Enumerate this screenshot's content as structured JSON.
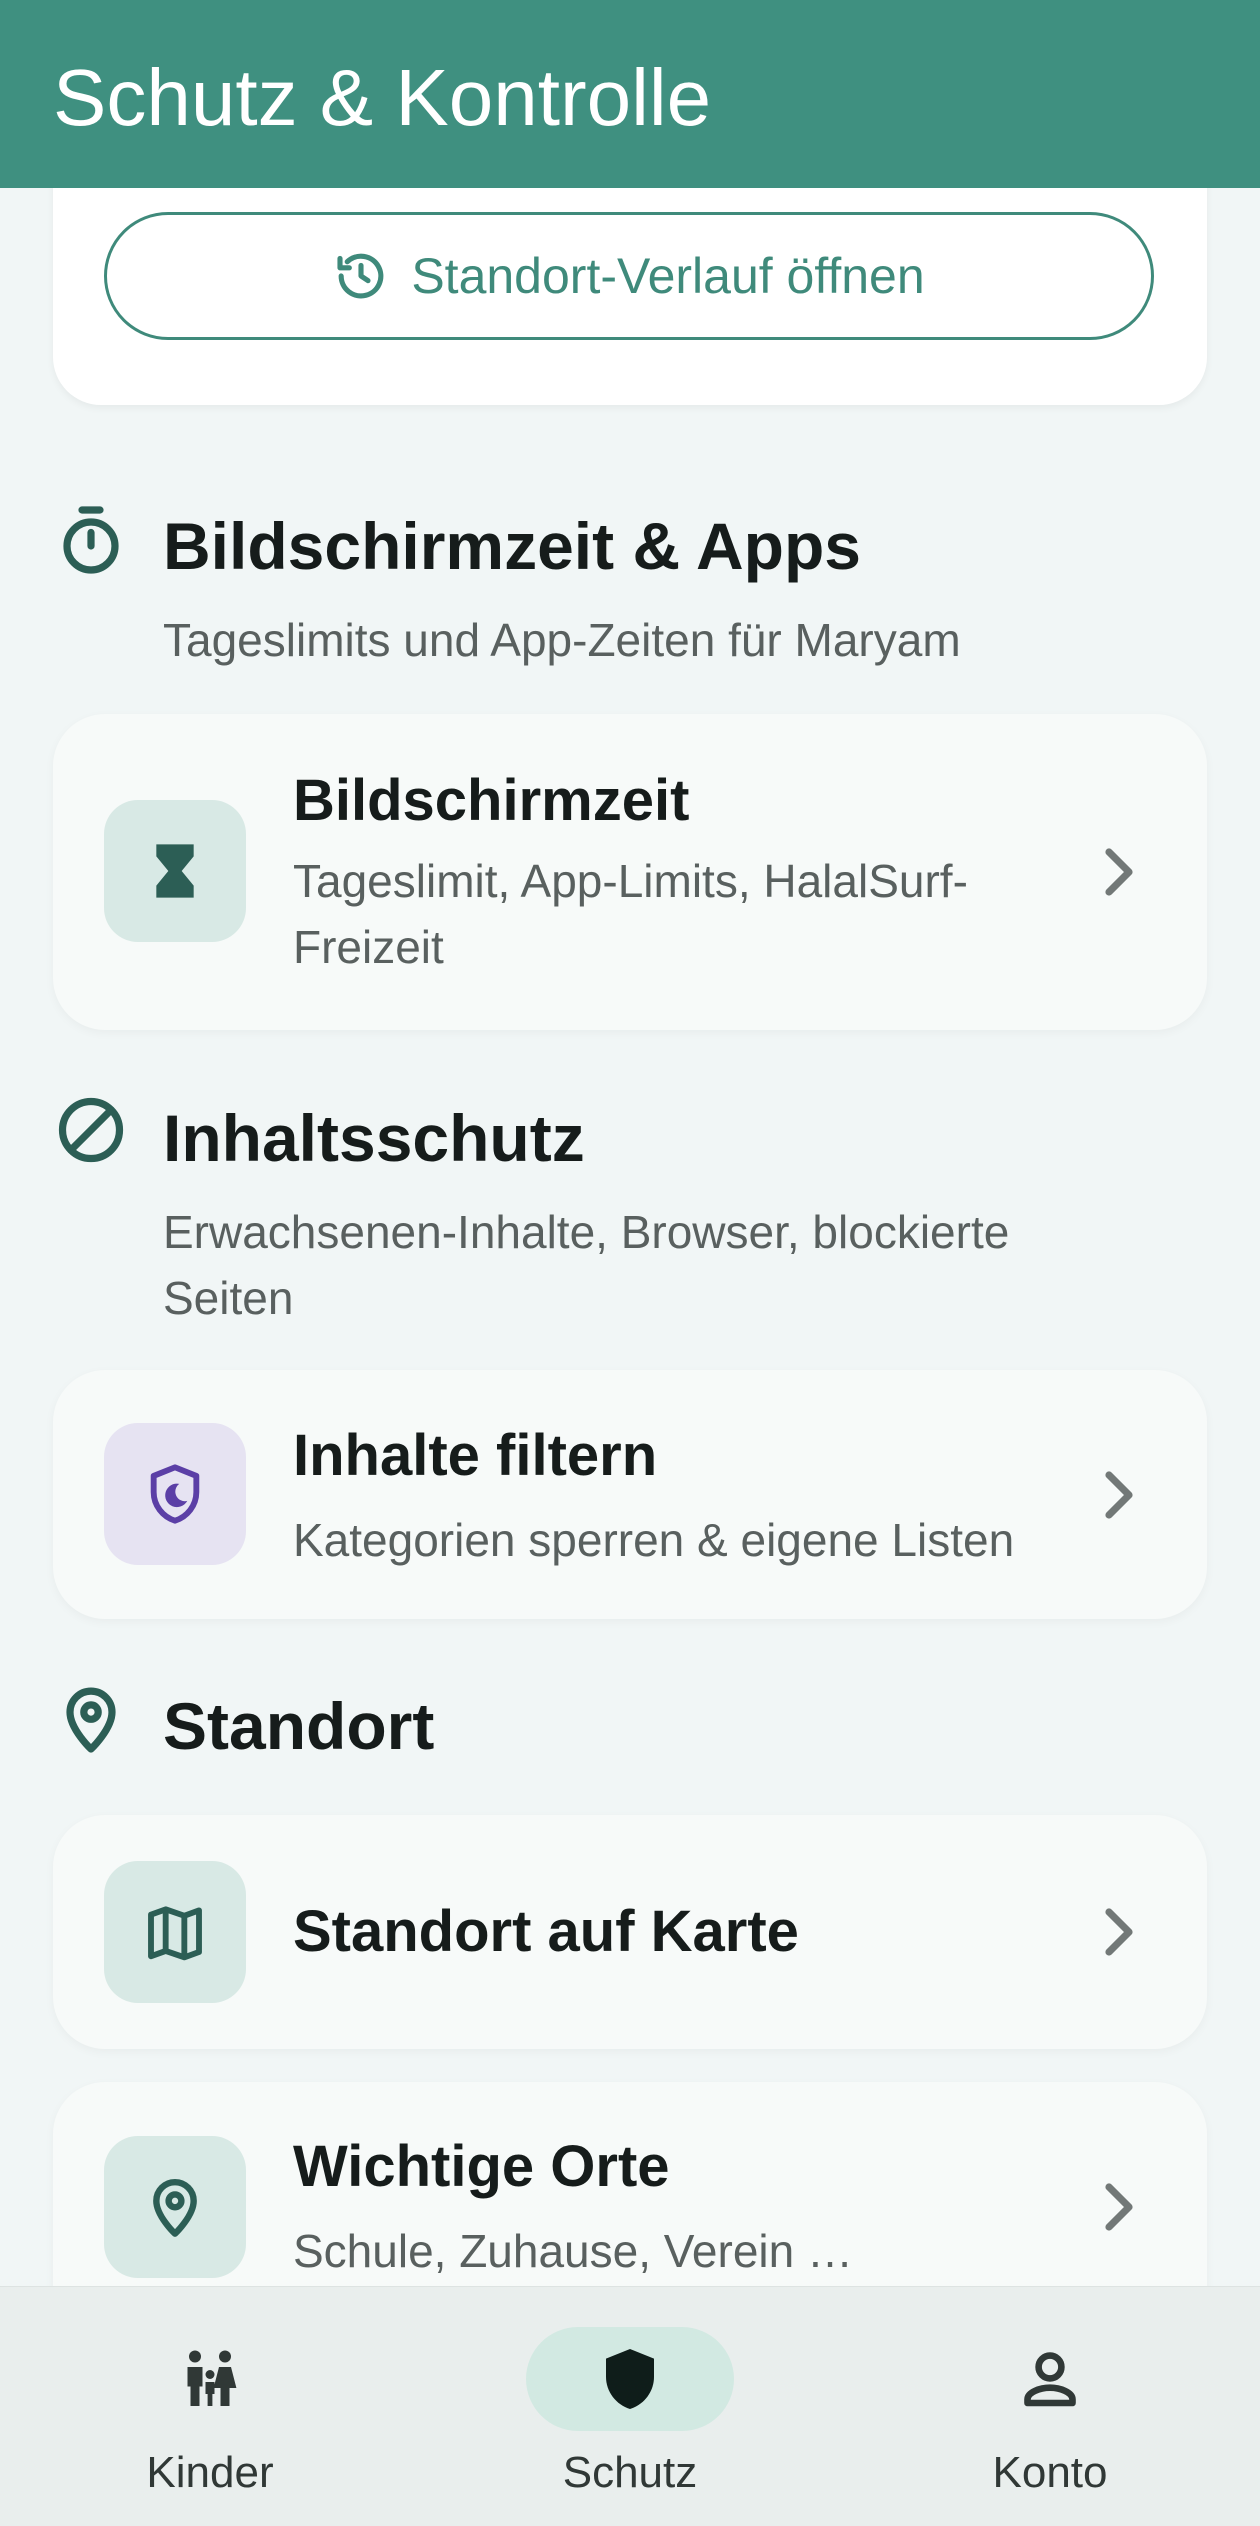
{
  "appbar": {
    "title": "Schutz & Kontrolle"
  },
  "location_card": {
    "history_button": "Standort-Verlauf öffnen"
  },
  "sections": {
    "screen_time": {
      "title": "Bildschirmzeit & Apps",
      "subtitle": "Tageslimits und App-Zeiten für Maryam",
      "card": {
        "title": "Bildschirmzeit",
        "subtitle": "Tageslimit, App-Limits, HalalSurf-Freizeit"
      }
    },
    "content": {
      "title": "Inhaltsschutz",
      "subtitle": "Erwachsenen-Inhalte, Browser, blockierte Seiten",
      "card": {
        "title": "Inhalte filtern",
        "subtitle": "Kategorien sperren & eigene Listen"
      }
    },
    "location": {
      "title": "Standort",
      "map_card": {
        "title": "Standort auf Karte"
      },
      "places_card": {
        "title": "Wichtige Orte",
        "subtitle": "Schule, Zuhause, Verein …"
      }
    }
  },
  "bottom_nav": {
    "items": [
      {
        "label": "Kinder",
        "icon": "family-icon"
      },
      {
        "label": "Schutz",
        "icon": "shield-icon",
        "active": true
      },
      {
        "label": "Konto",
        "icon": "person-icon"
      }
    ]
  },
  "colors": {
    "primary": "#3f9080",
    "icon_dark_green": "#2c5e55",
    "accent_purple": "#5b3fa6",
    "background": "#f1f6f6"
  }
}
